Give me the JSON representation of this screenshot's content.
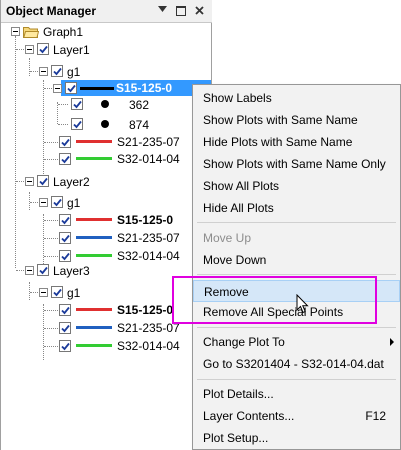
{
  "panel": {
    "title": "Object Manager",
    "tree": {
      "graph": "Graph1",
      "layer1": "Layer1",
      "layer2": "Layer2",
      "layer3": "Layer3",
      "group": "g1",
      "plots": {
        "p1": "S15-125-0",
        "p1_points": [
          "362",
          "874"
        ],
        "p2": "S21-235-07",
        "p3": "S32-014-04",
        "p4": "S15-125-0",
        "p5": "S21-235-07",
        "p6": "S32-014-04",
        "p7": "S15-125-0",
        "p8": "S21-235-07",
        "p9": "S32-014-04"
      }
    }
  },
  "menu": {
    "show_labels": "Show Labels",
    "show_same_name": "Show Plots with Same Name",
    "hide_same_name": "Hide Plots with Same Name",
    "show_same_name_only": "Show Plots with Same Name Only",
    "show_all": "Show All Plots",
    "hide_all": "Hide All Plots",
    "move_up": "Move Up",
    "move_down": "Move Down",
    "remove": "Remove",
    "remove_special": "Remove All Special Points",
    "change_plot_to": "Change Plot To",
    "go_to": "Go to S3201404 - S32-014-04.dat",
    "plot_details": "Plot Details...",
    "layer_contents": "Layer Contents...",
    "layer_contents_shortcut": "F12",
    "plot_setup": "Plot Setup..."
  },
  "colors": {
    "black": "#000000",
    "red": "#e03030",
    "green": "#33cc33",
    "blue": "#2060c0",
    "selection": "#3399ff",
    "highlight_box": "#e000e0"
  }
}
